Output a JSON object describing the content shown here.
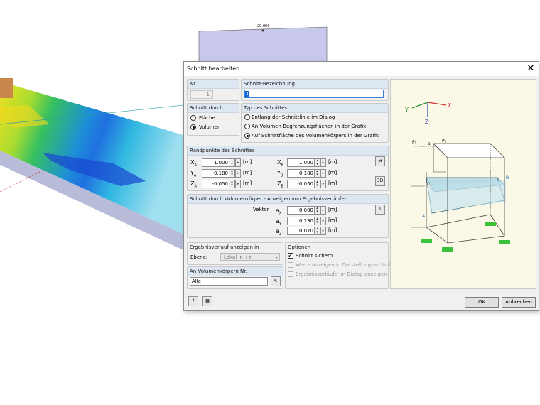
{
  "viewport": {
    "top_value": "20.000"
  },
  "dialog": {
    "title": "Schnitt bearbeiten",
    "nr": {
      "label": "Nr.",
      "value": "1"
    },
    "bezeichnung": {
      "label": "Schnitt-Bezeichnung",
      "value": "1"
    },
    "schnitt_durch": {
      "label": "Schnitt durch",
      "options": [
        "Fläche",
        "Volumen"
      ],
      "selected": "Volumen"
    },
    "typ": {
      "label": "Typ des Schnittes",
      "options": [
        "Entlang der Schnittlinie im Dialog",
        "An Volumen-Begrenzungsflächen in der Grafik",
        "Auf Schnittfläche des Volumenkörpers in der Grafik"
      ],
      "selected": "Auf Schnittfläche des Volumenkörpers in der Grafik"
    },
    "randpunkte": {
      "label": "Randpunkte des Schnittes",
      "unit": "[m]",
      "xa_label": "X",
      "xa_sub": "A",
      "xa": "1.000",
      "ya_label": "Y",
      "ya_sub": "A",
      "ya": "0.180",
      "za_label": "Z",
      "za_sub": "A",
      "za": "-0.050",
      "xb_label": "X",
      "xb_sub": "B",
      "xb": "1.000",
      "yb_label": "Y",
      "yb_sub": "B",
      "yb": "-0.180",
      "zb_label": "Z",
      "zb_sub": "B",
      "zb": "-0.050"
    },
    "volumen": {
      "label": "Schnitt durch Volumenkörper - Anzeigen von Ergebnisverläufen",
      "vektor_label": "Vektor",
      "unit": "[m]",
      "ax_label": "a",
      "ax_sub": "X",
      "ax": "0.000",
      "ay_label": "a",
      "ay_sub": "Y",
      "ay": "0.130",
      "az_label": "a",
      "az_sub": "Z",
      "az": "0.070"
    },
    "ergebnis": {
      "label": "Ergebnisverlauf anzeigen in",
      "ebene_label": "Ebene:",
      "ebene_value": "Lokal in +z"
    },
    "volumenkoerper": {
      "label": "An Volumenkörpern Nr.",
      "value": "Alle"
    },
    "optionen": {
      "label": "Optionen",
      "schnitt_sichern": "Schnitt sichern",
      "werte_isolinien": "Werte anzeigen in Darstellungsart Isolinien",
      "ergebnis_dialog": "Ergebnisverläufe im Dialog anzeigen"
    },
    "ok": "OK",
    "abbrechen": "Abbrechen",
    "preview": {
      "axis_x": "X",
      "axis_y": "Y",
      "axis_z": "Z",
      "p1": "P",
      "p1_sub": "1",
      "p2": "P",
      "p2_sub": "2",
      "a": "a",
      "pt_a": "A",
      "pt_b": "B"
    }
  }
}
